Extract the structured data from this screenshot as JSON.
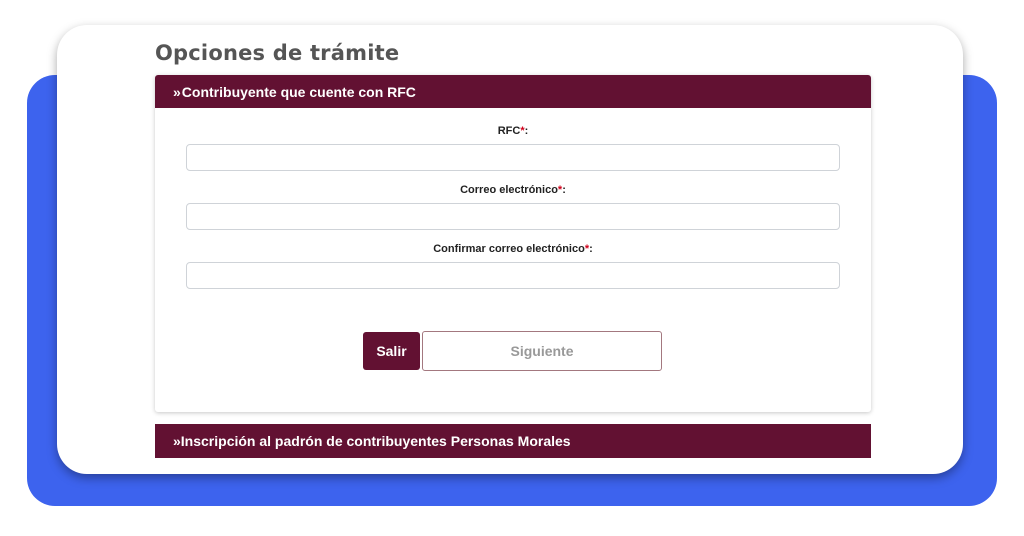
{
  "page": {
    "title": "Opciones de trámite"
  },
  "panel": {
    "chevron": "»",
    "header": "Contribuyente que cuente con RFC",
    "required_mark": "*",
    "fields": [
      {
        "label": "RFC",
        "value": ""
      },
      {
        "label": "Correo electrónico",
        "value": ""
      },
      {
        "label": "Confirmar correo electrónico",
        "value": ""
      }
    ],
    "buttons": {
      "exit": "Salir",
      "next": "Siguiente"
    }
  },
  "section2": {
    "chevron": "»",
    "header": "Inscripción al padrón de contribuyentes Personas Morales"
  },
  "colors": {
    "brand": "#621132",
    "backdrop": "#3d63ee",
    "required": "#d0021b"
  }
}
